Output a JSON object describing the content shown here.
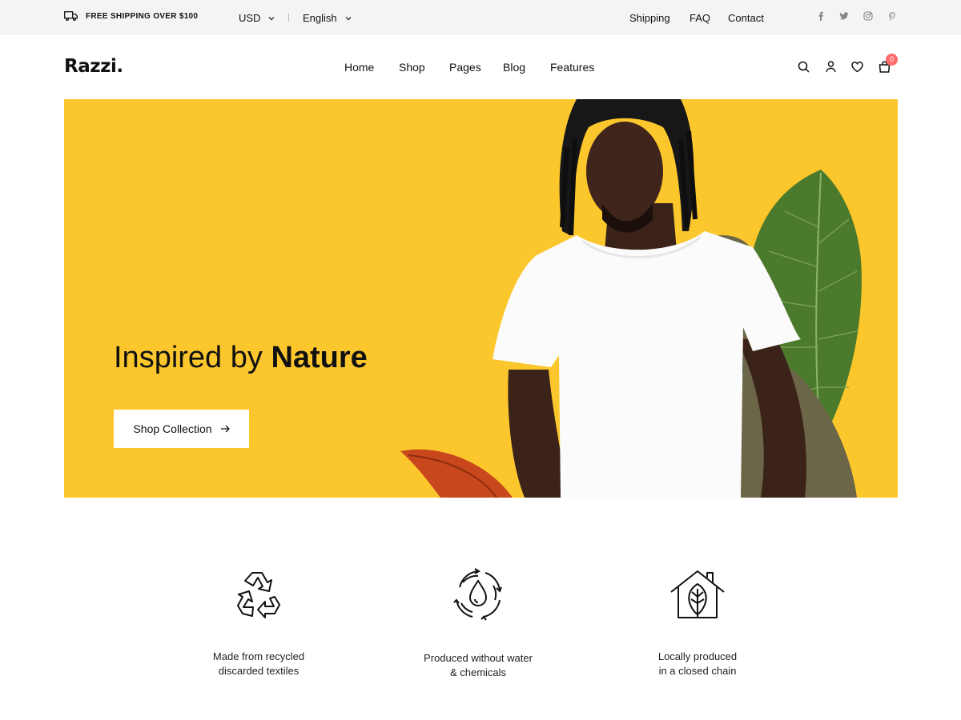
{
  "topbar": {
    "shipping_notice": "FREE SHIPPING OVER $100",
    "currency": "USD",
    "language": "English",
    "links": [
      "Shipping",
      "FAQ",
      "Contact"
    ],
    "social_icons": [
      "facebook-icon",
      "twitter-icon",
      "instagram-icon",
      "pinterest-icon"
    ]
  },
  "header": {
    "logo": "Razzi.",
    "nav": [
      "Home",
      "Shop",
      "Pages",
      "Blog",
      "Features"
    ],
    "icons": [
      "search-icon",
      "user-icon",
      "heart-icon",
      "cart-icon"
    ],
    "cart_count": "0"
  },
  "hero": {
    "heading_light": "Inspired by ",
    "heading_bold": "Nature",
    "button_label": "Shop Collection",
    "background_color": "#fcc72c"
  },
  "features": [
    {
      "icon": "recycle-icon",
      "line1": "Made from recycled",
      "line2": "discarded textiles"
    },
    {
      "icon": "water-drop-icon",
      "line1": "Produced without water",
      "line2": "& chemicals"
    },
    {
      "icon": "eco-house-icon",
      "line1": "Locally produced",
      "line2": "in a closed chain"
    }
  ],
  "colors": {
    "accent_badge": "#ff6b6b",
    "topbar_bg": "#f4f4f4",
    "text": "#111111"
  }
}
